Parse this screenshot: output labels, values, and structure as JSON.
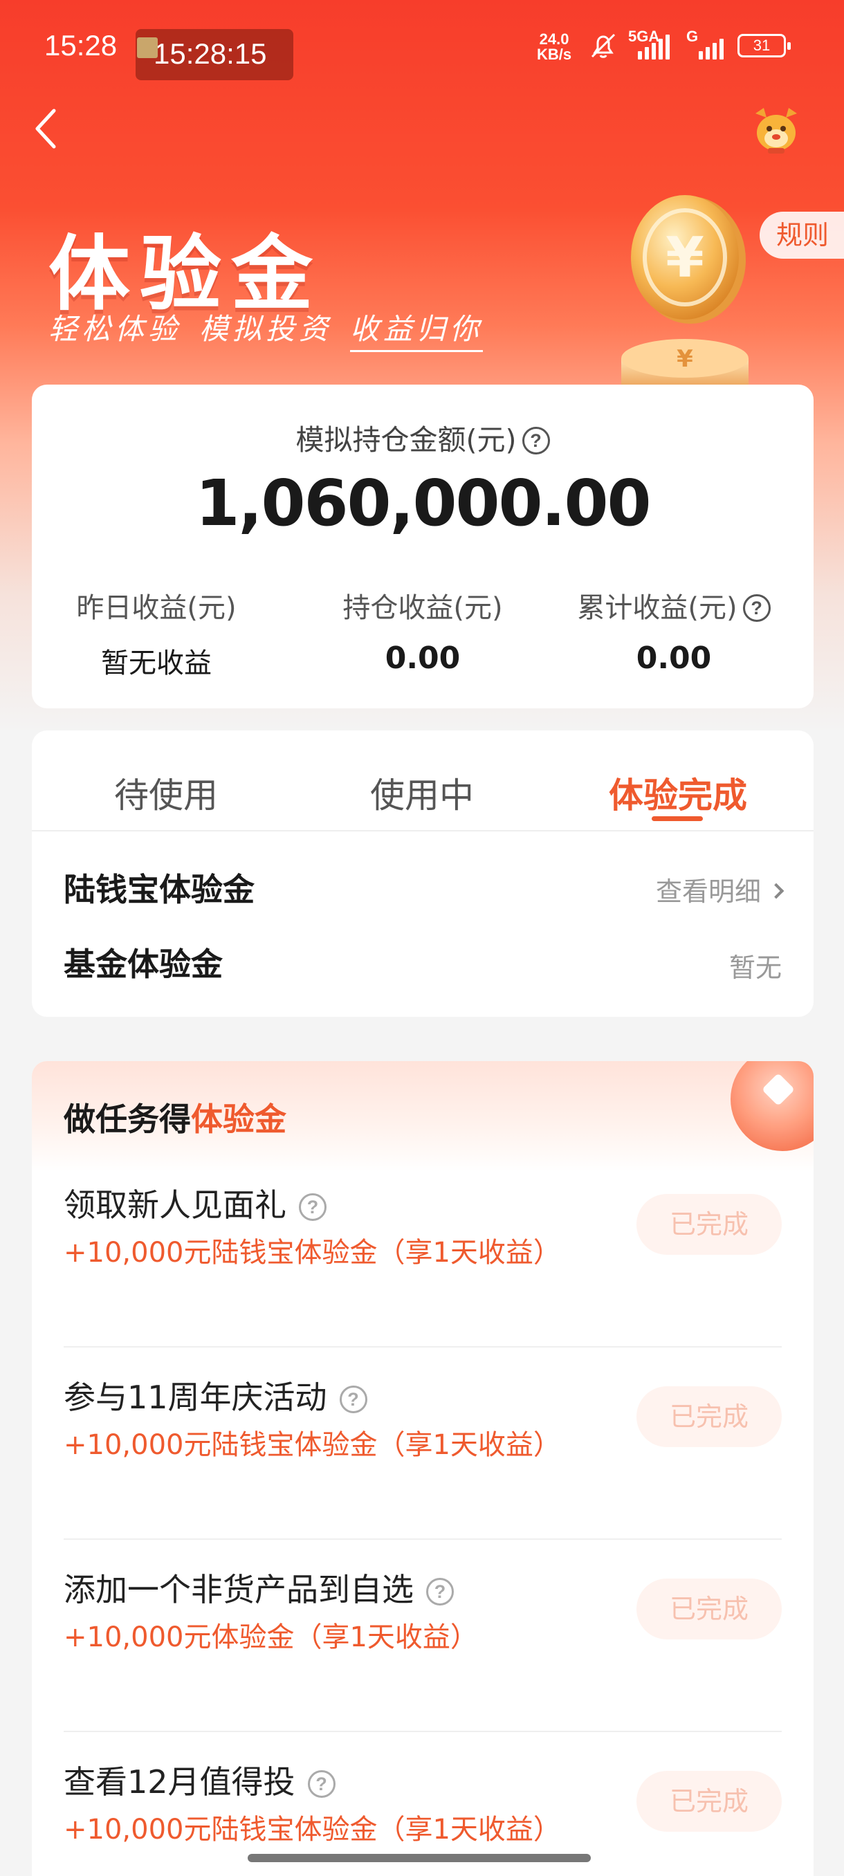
{
  "status_bar": {
    "time": "15:28",
    "clock_overlay": "15:28:15",
    "net_speed_value": "24.0",
    "net_speed_unit": "KB/s",
    "signal_1_label": "5GA",
    "signal_2_label": "G",
    "battery": "31"
  },
  "hero": {
    "title": "体验金",
    "slogan_1": "轻松体验",
    "slogan_2": "模拟投资",
    "slogan_3": "收益归你",
    "rules_label": "规则"
  },
  "summary": {
    "holding_label": "模拟持仓金额(元)",
    "holding_amount": "1,060,000.00",
    "stats": [
      {
        "label": "昨日收益(元)",
        "value": "暂无收益"
      },
      {
        "label": "持仓收益(元)",
        "value": "0.00"
      },
      {
        "label": "累计收益(元)",
        "value": "0.00"
      }
    ]
  },
  "tabs": {
    "items": [
      "待使用",
      "使用中",
      "体验完成"
    ],
    "active_index": 2
  },
  "experience_rows": [
    {
      "title": "陆钱宝体验金",
      "action": "查看明细"
    },
    {
      "title": "基金体验金",
      "action": "暂无"
    }
  ],
  "tasks": {
    "heading_prefix": "做任务得",
    "heading_highlight": "体验金",
    "items": [
      {
        "title": "领取新人见面礼",
        "reward": "+10,000元陆钱宝体验金（享1天收益）",
        "status": "已完成"
      },
      {
        "title": "参与11周年庆活动",
        "reward": "+10,000元陆钱宝体验金（享1天收益）",
        "status": "已完成"
      },
      {
        "title": "添加一个非货产品到自选",
        "reward": "+10,000元体验金（享1天收益）",
        "status": "已完成"
      },
      {
        "title": "查看12月值得投",
        "reward": "+10,000元陆钱宝体验金（享1天收益）",
        "status": "已完成"
      }
    ]
  },
  "colors": {
    "brand_red": "#f73d2b",
    "accent_orange": "#ef5a2e",
    "page_bg": "#f4f4f4"
  },
  "icons": [
    "back-arrow-icon",
    "mascot-icon",
    "coin-icon",
    "help-icon",
    "chevron-right-icon",
    "bell-off-icon",
    "signal-icon",
    "battery-icon"
  ]
}
